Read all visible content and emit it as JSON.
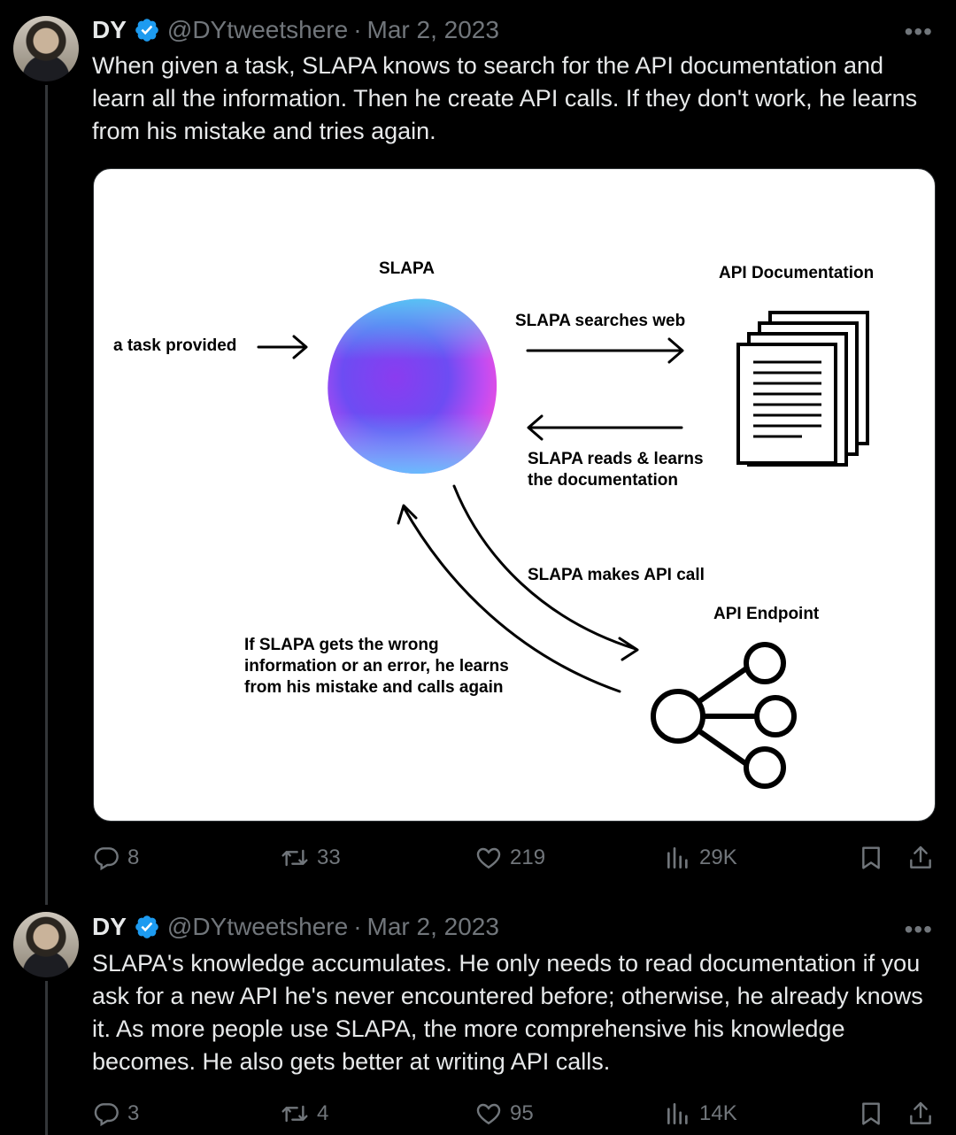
{
  "tweets": [
    {
      "name": "DY",
      "handle": "@DYtweetshere",
      "sep": "·",
      "date": "Mar 2, 2023",
      "more": "•••",
      "text": "When given a task, SLAPA knows to search for the API documentation and learn all the information. Then he create API calls. If they don't work, he learns from his mistake and tries again.",
      "replies": "8",
      "retweets": "33",
      "likes": "219",
      "views": "29K"
    },
    {
      "name": "DY",
      "handle": "@DYtweetshere",
      "sep": "·",
      "date": "Mar 2, 2023",
      "more": "•••",
      "text": "SLAPA's knowledge accumulates. He only needs to read documentation if you ask for a new API he's never encountered before; otherwise, he already knows it. As more people use SLAPA, the more comprehensive his knowledge becomes. He also gets better at writing API calls.",
      "replies": "3",
      "retweets": "4",
      "likes": "95",
      "views": "14K"
    }
  ],
  "diagram": {
    "slapa": "SLAPA",
    "api_doc": "API  Documentation",
    "task": "a task provided",
    "searches": "SLAPA searches web",
    "reads_1": "SLAPA reads & learns",
    "reads_2": "the documentation",
    "makes_call": "SLAPA makes API call",
    "endpoint": "API Endpoint",
    "error_1": "If SLAPA gets the wrong",
    "error_2": "information or an error, he learns",
    "error_3": "from his mistake and calls again"
  },
  "colors": {
    "background": "#000000",
    "text": "#e7e9ea",
    "muted": "#71767b",
    "verified": "#1d9bf0"
  }
}
